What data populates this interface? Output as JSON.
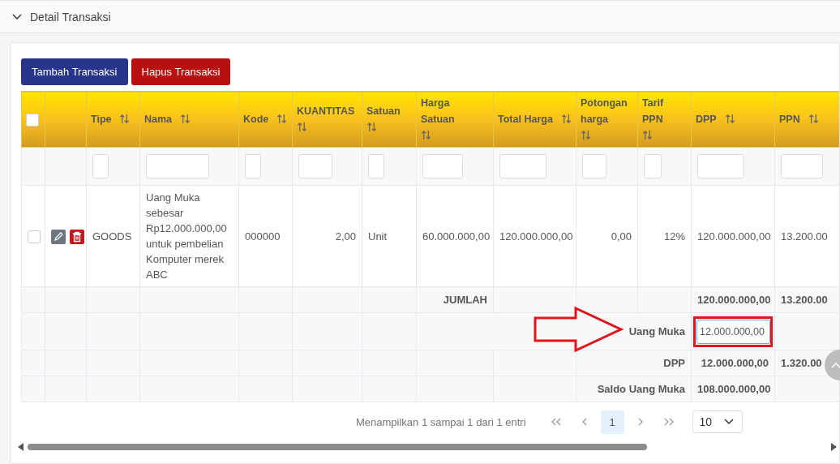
{
  "section": {
    "title": "Detail Transaksi",
    "expanded": true
  },
  "buttons": [
    {
      "label": "Tambah Transaksi",
      "kind": "primary"
    },
    {
      "label": "Hapus Transaksi",
      "kind": "danger"
    }
  ],
  "table": {
    "select_all": {
      "checked": false
    },
    "columns": [
      "Tipe",
      "Nama",
      "Kode",
      "KUANTITAS",
      "Satuan",
      "Harga Satuan",
      "Total Harga",
      "Potongan harga",
      "Tarif PPN",
      "DPP",
      "PPN"
    ],
    "rows": [
      {
        "checked": false,
        "cells": [
          "GOODS",
          "Uang Muka sebesar Rp12.000.000,00 untuk pembelian Komputer merek ABC",
          "000000",
          "2,00",
          "Unit",
          "60.000.000,00",
          "120.000.000,00",
          "0,00",
          "12%",
          "120.000.000,00",
          "13.200.00"
        ]
      }
    ],
    "summary": [
      {
        "kind": "total",
        "label": "JUMLAH",
        "dpp": "120.000.000,00",
        "ppn": "13.200.00"
      },
      {
        "kind": "input",
        "label": "Uang Muka",
        "dpp": "12.000.000,00",
        "highlighted": true
      },
      {
        "kind": "plain",
        "label": "DPP",
        "dpp": "12.000.000,00",
        "ppn": "1.320.00"
      },
      {
        "kind": "plain",
        "label": "Saldo Uang Muka",
        "dpp": "108.000.000,00"
      }
    ]
  },
  "pagination": {
    "info": "Menampilkan 1 sampai 1 dari 1 entri",
    "pages": [
      {
        "label": "1",
        "selected": true
      }
    ],
    "page_size": "10"
  }
}
